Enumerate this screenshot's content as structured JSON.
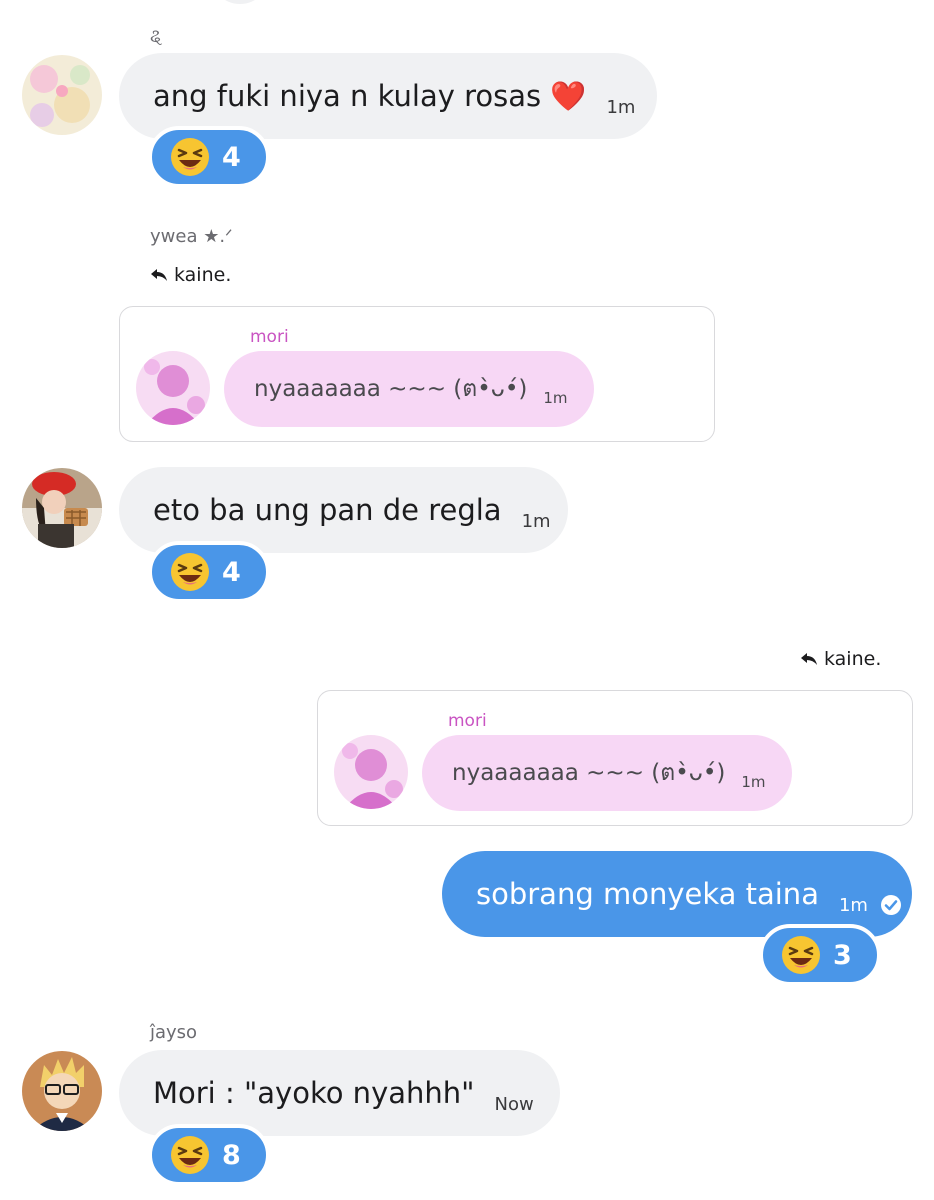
{
  "messages": [
    {
      "sender": "ୡ",
      "text": "ang fuki niya n kulay rosas ❤️",
      "time": "1m",
      "reaction": {
        "icon": "laughing-face-icon",
        "count": "4"
      }
    },
    {
      "sender": "ywea ★.ᐟ",
      "reply_to": "kaine.",
      "quote": {
        "name": "mori",
        "text": "nyaaaaaaa ~~~ (ต•̀ᴗ•́)",
        "time": "1m"
      },
      "text": "eto ba ung pan de regla",
      "time": "1m",
      "reaction": {
        "icon": "laughing-face-icon",
        "count": "4"
      }
    },
    {
      "own": true,
      "reply_to": "kaine.",
      "quote": {
        "name": "mori",
        "text": "nyaaaaaaa ~~~ (ต•̀ᴗ•́)",
        "time": "1m"
      },
      "text": "sobrang monyeka taina",
      "time": "1m",
      "status_icon": "read-check-icon",
      "reaction": {
        "icon": "laughing-face-icon",
        "count": "3"
      }
    },
    {
      "sender": "ĵayso",
      "text": "Mori : \"ayoko nyahhh\"",
      "time": "Now",
      "reaction": {
        "icon": "laughing-face-icon",
        "count": "8"
      }
    }
  ],
  "colors": {
    "accent": "#4a96e8",
    "bubble_other": "#f0f1f3",
    "quote_bubble": "#f7d7f5",
    "quote_name": "#c954c2"
  }
}
